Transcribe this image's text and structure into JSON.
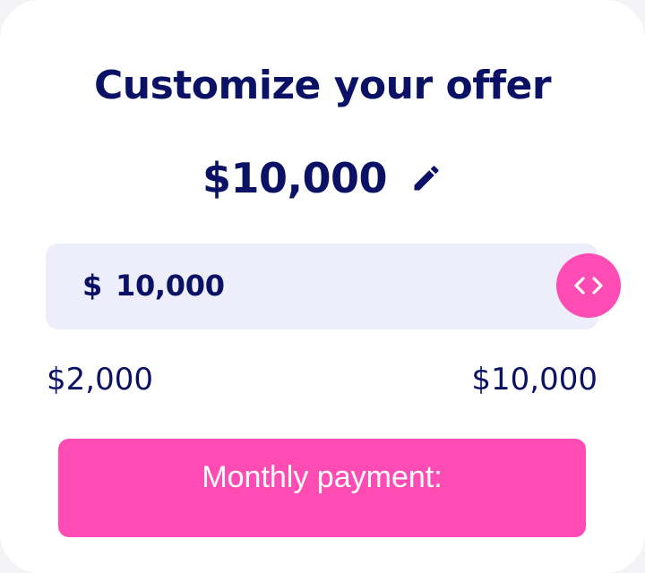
{
  "offer": {
    "title": "Customize your offer",
    "amount_display": "$10,000"
  },
  "slider": {
    "currency_symbol": "$",
    "value": "10,000",
    "level": 1.0,
    "min_label": "$2,000",
    "max_label": "$10,000"
  },
  "payment": {
    "button_label": "Monthly payment:"
  },
  "icons": {
    "edit": "pencil-icon",
    "handle": "chevrons-left-right-icon"
  },
  "colors": {
    "primary_text": "#0b1266",
    "accent": "#ff4bb4",
    "track": "#eeeefb",
    "card": "#ffffff"
  }
}
